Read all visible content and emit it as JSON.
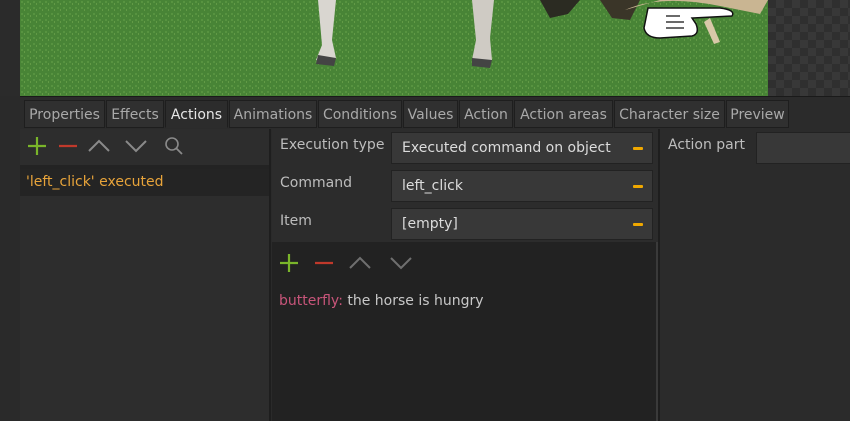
{
  "colors": {
    "accent_orange": "#e8a43a",
    "add_green": "#7ab52a",
    "remove_red": "#c0392b",
    "speaker_pink": "#c8557a",
    "caret_yellow": "#f0a800"
  },
  "tabs": [
    {
      "label": "Properties",
      "active": false
    },
    {
      "label": "Effects",
      "active": false
    },
    {
      "label": "Actions",
      "active": true
    },
    {
      "label": "Animations",
      "active": false
    },
    {
      "label": "Conditions",
      "active": false
    },
    {
      "label": "Values",
      "active": false
    },
    {
      "label": "Action",
      "active": false
    },
    {
      "label": "Action areas",
      "active": false
    },
    {
      "label": "Character size",
      "active": false
    },
    {
      "label": "Preview",
      "active": false
    }
  ],
  "actions_list": {
    "toolbar_icons": [
      "add-icon",
      "remove-icon",
      "move-up-icon",
      "move-down-icon",
      "search-icon"
    ],
    "items": [
      {
        "label": "'left_click' executed",
        "selected": true
      }
    ]
  },
  "action_detail": {
    "execution_type": {
      "label": "Execution type",
      "value": "Executed command on object"
    },
    "command": {
      "label": "Command",
      "value": "left_click"
    },
    "item": {
      "label": "Item",
      "value": "[empty]"
    },
    "toolbar_icons": [
      "add-icon",
      "remove-icon",
      "move-up-icon",
      "move-down-icon"
    ],
    "script": [
      {
        "speaker": "butterfly:",
        "text": " the horse is hungry"
      }
    ]
  },
  "action_part": {
    "label": "Action part",
    "value": ""
  }
}
